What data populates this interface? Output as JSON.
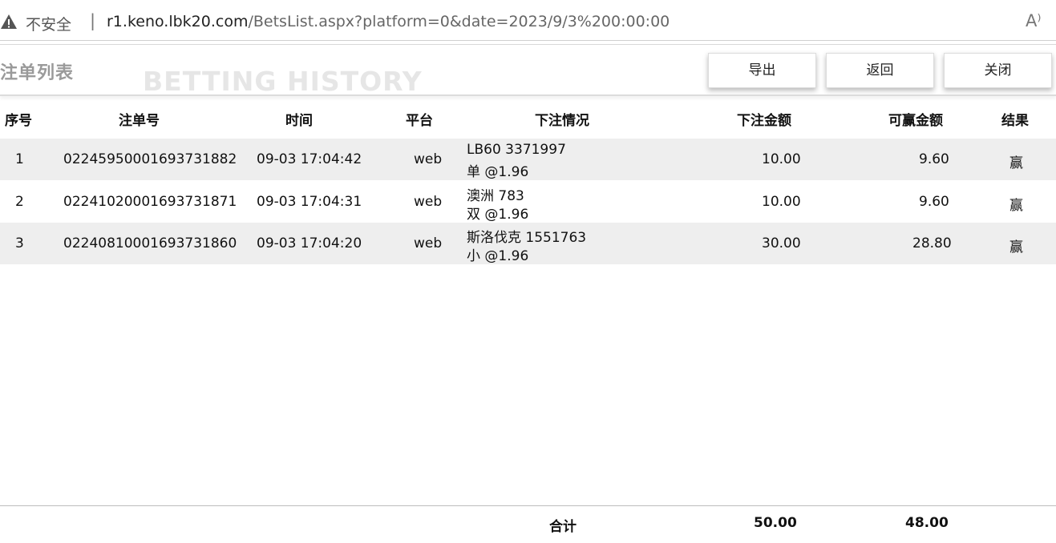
{
  "browser": {
    "insecure_label": "不安全",
    "separator": "|",
    "url_host": "r1.keno.lbk20.com",
    "url_path": "/BetsList.aspx?platform=0&date=2023/9/3%200:00:00",
    "read_aloud_glyph": "A⁾"
  },
  "page": {
    "title": "注单列表",
    "watermark": "BETTING HISTORY",
    "buttons": {
      "export": "导出",
      "back": "返回",
      "close": "关闭"
    }
  },
  "table": {
    "headers": [
      "序号",
      "注单号",
      "时间",
      "平台",
      "下注情况",
      "下注金额",
      "可赢金额",
      "结果"
    ],
    "rows": [
      {
        "no": "1",
        "ticket": "02245950001693731882",
        "time": "09-03 17:04:42",
        "platform": "web",
        "bet_line1": "LB60 3371997",
        "bet_line2": "单 @1.96",
        "stake": "10.00",
        "win": "9.60",
        "result": "赢"
      },
      {
        "no": "2",
        "ticket": "02241020001693731871",
        "time": "09-03 17:04:31",
        "platform": "web",
        "bet_line1": "澳洲 783",
        "bet_line2": "双 @1.96",
        "stake": "10.00",
        "win": "9.60",
        "result": "赢"
      },
      {
        "no": "3",
        "ticket": "02240810001693731860",
        "time": "09-03 17:04:20",
        "platform": "web",
        "bet_line1": "斯洛伐克 1551763",
        "bet_line2": "小 @1.96",
        "stake": "30.00",
        "win": "28.80",
        "result": "赢"
      }
    ],
    "footer": {
      "label": "合计",
      "stake_total": "50.00",
      "win_total": "48.00"
    }
  },
  "colors": {
    "row_shade": "#eeeeee",
    "title_gray": "#9a9a9a",
    "watermark": "#e6e6e6"
  }
}
